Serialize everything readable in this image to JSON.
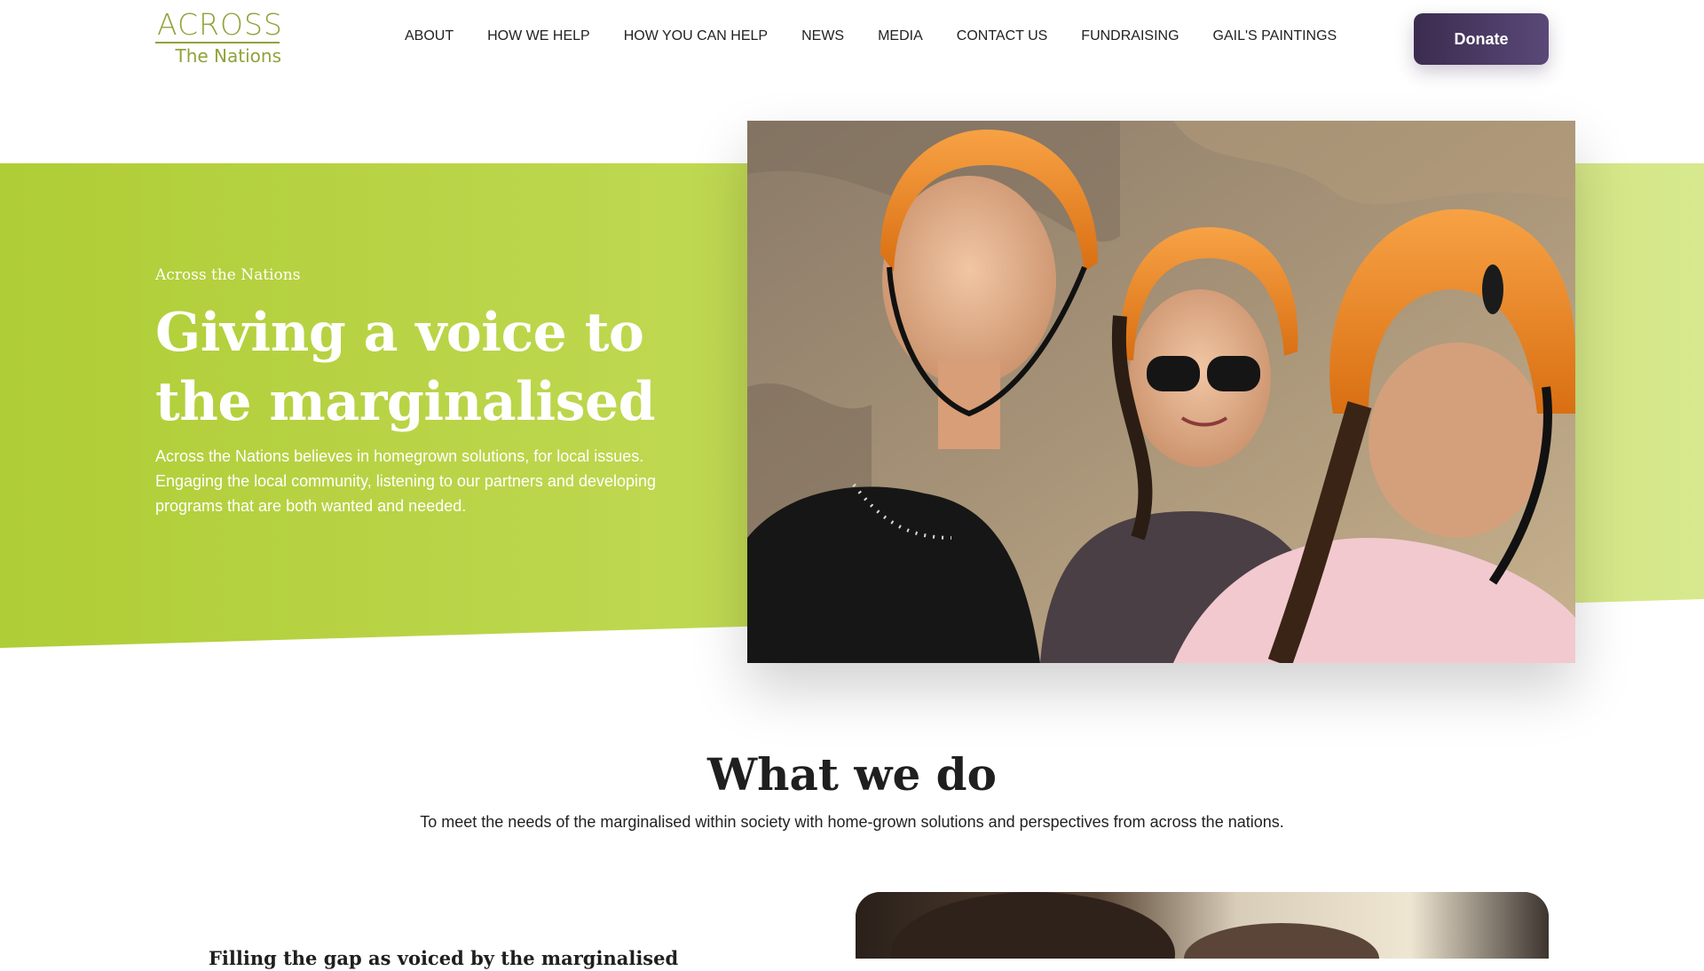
{
  "header": {
    "logo": {
      "top": "ACROSS",
      "bottom": "The Nations",
      "color": "#8fa33a"
    },
    "nav": [
      {
        "label": "ABOUT"
      },
      {
        "label": "HOW WE HELP"
      },
      {
        "label": "HOW YOU CAN HELP"
      },
      {
        "label": "NEWS"
      },
      {
        "label": "MEDIA"
      },
      {
        "label": "CONTACT US"
      },
      {
        "label": "FUNDRAISING"
      },
      {
        "label": "GAIL'S PAINTINGS"
      }
    ],
    "donate_label": "Donate",
    "donate_color": "#4a3a63"
  },
  "hero": {
    "eyebrow": "Across the Nations",
    "title": "Giving a voice to the marginalised",
    "description": "Across the Nations believes in homegrown solutions, for local issues. Engaging the local community, listening to our partners and developing programs that are both wanted and needed.",
    "accent_color": "#b5d23e",
    "photo_icon": "photo-three-girls-climbing-helmets"
  },
  "what_we_do": {
    "title": "What we do",
    "subtitle": "To meet the needs of the marginalised within society with home-grown solutions and perspectives from across the nations.",
    "feature_title": "Filling the gap as voiced by the marginalised",
    "feature_photo_icon": "photo-feature"
  }
}
